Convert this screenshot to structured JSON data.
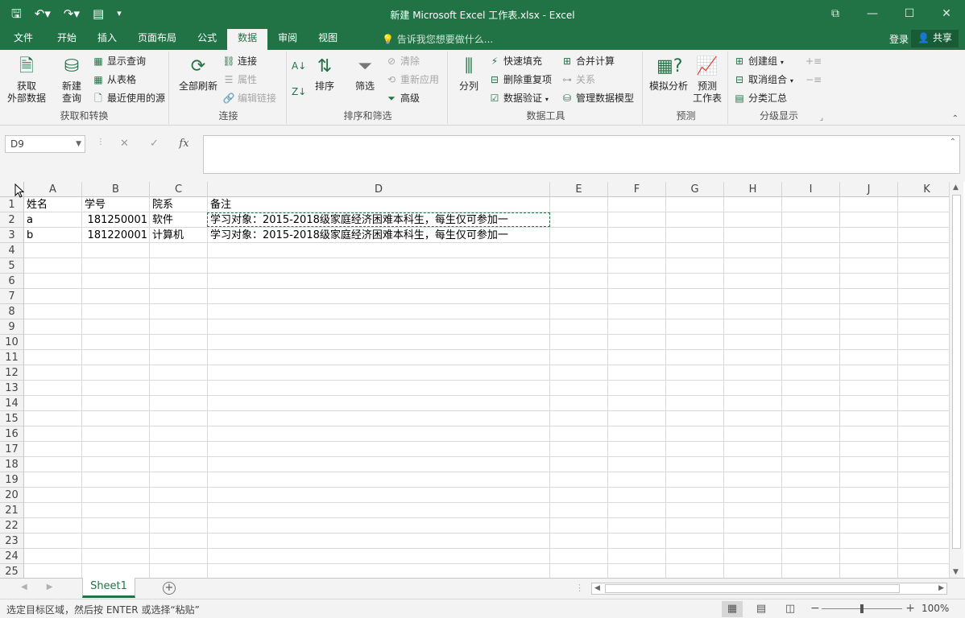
{
  "titlebar": {
    "title": "新建 Microsoft Excel 工作表.xlsx - Excel",
    "qat": [
      "save-icon",
      "undo-icon",
      "redo-icon",
      "form-icon",
      "customize-icon"
    ],
    "window_controls": [
      "ribbon-display-icon",
      "minimize-icon",
      "maximize-icon",
      "close-icon"
    ]
  },
  "tabs": {
    "items": [
      "文件",
      "开始",
      "插入",
      "页面布局",
      "公式",
      "数据",
      "审阅",
      "视图"
    ],
    "active": "数据",
    "tell_me": "告诉我您想要做什么...",
    "sign_in": "登录",
    "share": "共享"
  },
  "ribbon": {
    "get_external": "获取\n外部数据",
    "new_query": "新建\n查询",
    "show_queries": "显示查询",
    "from_table": "从表格",
    "recent_sources": "最近使用的源",
    "group_get_transform": "获取和转换",
    "refresh_all": "全部刷新",
    "connections": "连接",
    "properties": "属性",
    "edit_links": "编辑链接",
    "group_connections": "连接",
    "sort": "排序",
    "filter": "筛选",
    "clear": "清除",
    "reapply": "重新应用",
    "advanced": "高级",
    "group_sort_filter": "排序和筛选",
    "text_to_columns": "分列",
    "flash_fill": "快速填充",
    "remove_duplicates": "删除重复项",
    "data_validation": "数据验证",
    "consolidate": "合并计算",
    "relationships": "关系",
    "manage_data_model": "管理数据模型",
    "group_data_tools": "数据工具",
    "what_if": "模拟分析",
    "forecast_sheet": "预测\n工作表",
    "group_forecast": "预测",
    "group_btn": "创建组",
    "ungroup": "取消组合",
    "subtotal": "分类汇总",
    "group_outline": "分级显示"
  },
  "formula_bar": {
    "name_box": "D9",
    "cancel": "✕",
    "enter": "✓",
    "fx": "fx",
    "value": ""
  },
  "sheet": {
    "columns": [
      "A",
      "B",
      "C",
      "D",
      "E",
      "F",
      "G",
      "H",
      "I",
      "J",
      "K"
    ],
    "rows": [
      "1",
      "2",
      "3",
      "4",
      "5",
      "6",
      "7",
      "8",
      "9",
      "10",
      "11",
      "12",
      "13",
      "14",
      "15",
      "16",
      "17",
      "18",
      "19",
      "20",
      "21",
      "22",
      "23",
      "24",
      "25"
    ],
    "data": {
      "A1": "姓名",
      "B1": "学号",
      "C1": "院系",
      "D1": "备注",
      "A2": "a",
      "B2": "181250001",
      "C2": "软件",
      "D2": "学习对象：2015-2018级家庭经济困难本科生，每生仅可参加一",
      "A3": "b",
      "B3": "181220001",
      "C3": "计算机",
      "D3": "学习对象：2015-2018级家庭经济困难本科生，每生仅可参加一"
    },
    "tab": "Sheet1"
  },
  "status": {
    "message": "选定目标区域，然后按 ENTER 或选择“粘贴”",
    "zoom": "100%"
  },
  "colors": {
    "excel_green": "#217346",
    "ribbon_bg": "#f3f3f3"
  }
}
